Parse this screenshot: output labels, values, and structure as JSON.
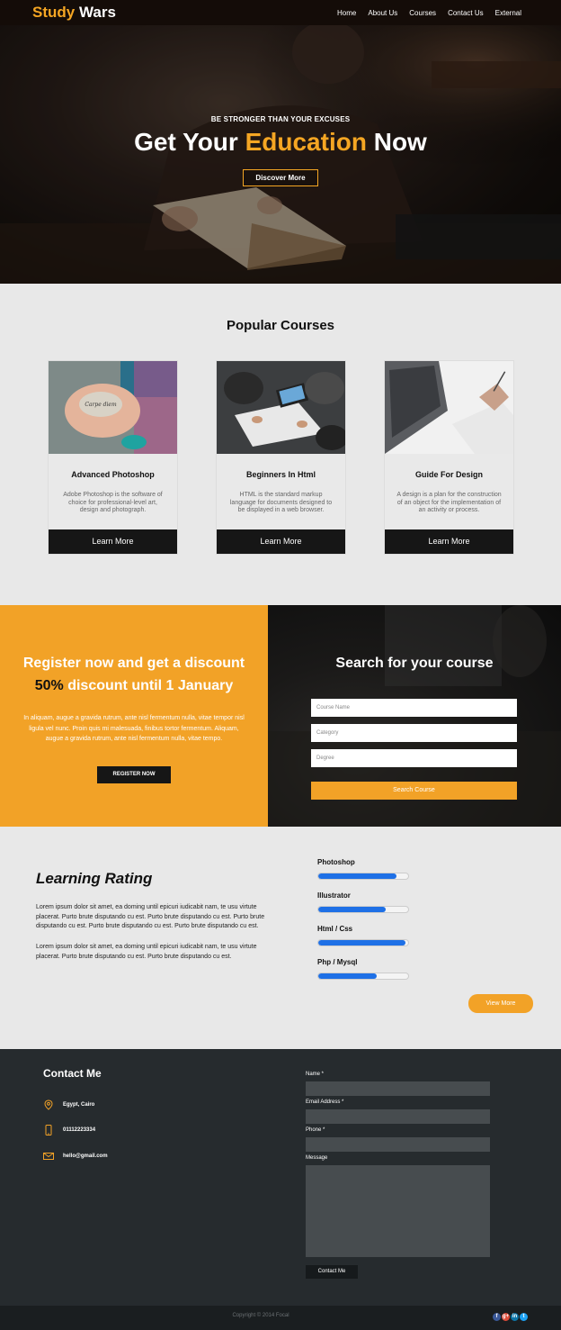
{
  "nav": {
    "logo_accent": "Study",
    "logo_rest": " Wars",
    "items": [
      "Home",
      "About Us",
      "Courses",
      "Contact Us",
      "External"
    ]
  },
  "hero": {
    "tagline": "BE STRONGER THAN YOUR EXCUSES",
    "title_start": "Get Your ",
    "title_accent": "Education",
    "title_end": " Now",
    "button": "Discover More"
  },
  "courses": {
    "title": "Popular Courses",
    "items": [
      {
        "title": "Advanced Photoshop",
        "desc": "Adobe Photoshop is the software of choice for professional-level art, design and photograph.",
        "button": "Learn More",
        "stone_text": "Carpe diem"
      },
      {
        "title": "Beginners In Html",
        "desc": "HTML is the standard markup language for documents designed to be displayed in a web browser.",
        "button": "Learn More"
      },
      {
        "title": "Guide For Design",
        "desc": "A design is a plan for the construction of an object for the implementation of an activity or process.",
        "button": "Learn More"
      }
    ]
  },
  "promo": {
    "line1": "Register now and get a discount",
    "percent": "50%",
    "line2": " discount until 1 January",
    "text": "In aliquam, augue a gravida rutrum, ante nisl fermentum nulla, vitae tempor nisl ligula vel nunc. Proin quis mi malesuada, finibus tortor fermentum. Aliquam, augue a gravida rutrum, ante nisl fermentum nulla, vitae tempo.",
    "button": "REGISTER NOW"
  },
  "search": {
    "title": "Search for your course",
    "placeholders": [
      "Course Name",
      "Category",
      "Degree"
    ],
    "button": "Search Course"
  },
  "rating": {
    "title": "Learning Rating",
    "para1": "Lorem ipsum dolor sit amet, ea doming until epicuri iudicabit nam, te usu virtute placerat. Purto brute disputando cu est. Purto brute disputando cu est. Purto brute disputando cu est. Purto brute disputando cu est. Purto brute disputando cu est.",
    "para2": "Lorem ipsum dolor sit amet, ea doming until epicuri iudicabit nam, te usu virtute placerat. Purto brute disputando cu est. Purto brute disputando cu est.",
    "skills": [
      {
        "label": "Photoshop",
        "value": 0.87
      },
      {
        "label": "Illustrator",
        "value": 0.75
      },
      {
        "label": "Html / Css",
        "value": 0.97
      },
      {
        "label": "Php / Mysql",
        "value": 0.65
      }
    ],
    "button": "View More"
  },
  "contact": {
    "title": "Contact Me",
    "info": [
      {
        "icon": "location-icon",
        "text": "Egypt, Cairo"
      },
      {
        "icon": "phone-icon",
        "text": "01112223334"
      },
      {
        "icon": "mail-icon",
        "text": "hello@gmail.com"
      }
    ],
    "labels": [
      "Name *",
      "Email Address *",
      "Phone *",
      "Message"
    ],
    "button": "Contact Me"
  },
  "footer": {
    "copyright": "Copyright © 2014 Focal",
    "social": [
      {
        "icon": "facebook-icon",
        "glyph": "f",
        "color": "#3b5998"
      },
      {
        "icon": "google-plus-icon",
        "glyph": "g+",
        "color": "#dd4b39"
      },
      {
        "icon": "linkedin-icon",
        "glyph": "in",
        "color": "#0e76a8"
      },
      {
        "icon": "twitter-icon",
        "glyph": "t",
        "color": "#1da1f2"
      }
    ]
  },
  "colors": {
    "accent": "#f2a227",
    "bar": "#1e70e6",
    "dark": "#161616"
  }
}
